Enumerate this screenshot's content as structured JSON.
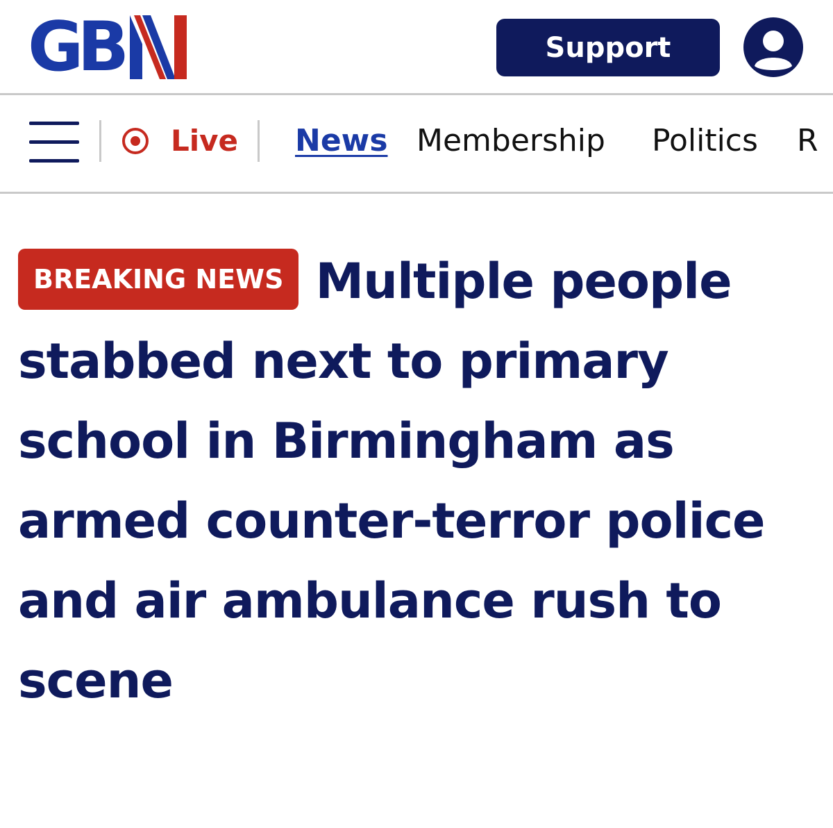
{
  "header": {
    "logo_text": "GBN",
    "support_label": "Support"
  },
  "nav": {
    "live_label": "Live",
    "items": [
      {
        "label": "News",
        "active": true
      },
      {
        "label": "Membership",
        "active": false
      },
      {
        "label": "Politics",
        "active": false
      },
      {
        "label": "R",
        "active": false
      }
    ]
  },
  "article": {
    "badge": "BREAKING NEWS",
    "title": "Multiple people stabbed next to primary school in Birmingham as armed counter-terror police and air ambulance rush to scene"
  },
  "colors": {
    "brand_navy": "#0f1a5c",
    "brand_blue": "#1a3aa6",
    "accent_red": "#c62a1f"
  },
  "icons": {
    "menu": "hamburger-menu-icon",
    "live": "live-record-icon",
    "account": "user-account-icon"
  }
}
